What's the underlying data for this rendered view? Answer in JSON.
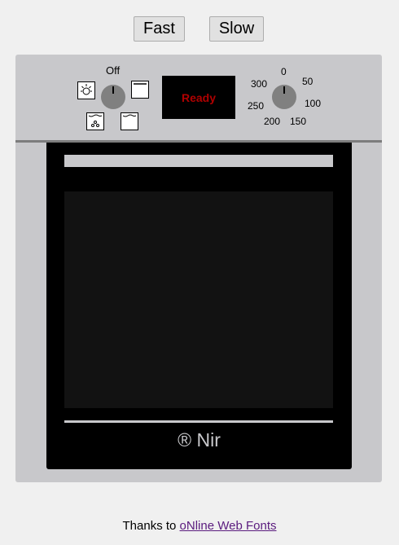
{
  "controls": {
    "fast_label": "Fast",
    "slow_label": "Slow"
  },
  "oven": {
    "mode_knob_label": "Off",
    "display_text": "Ready",
    "display_text_color": "#b00000",
    "temperature_marks": [
      "0",
      "50",
      "100",
      "150",
      "200",
      "250",
      "300"
    ],
    "mode_icons": [
      "light-icon",
      "top-heat-icon",
      "fan-icon",
      "bottom-heat-icon"
    ],
    "brand": "® Nir"
  },
  "footer": {
    "prefix": "Thanks to ",
    "link_text": "oNline Web Fonts"
  },
  "colors": {
    "body_bg": "#c8c8cb",
    "door": "#000000",
    "window": "#121212",
    "knob": "#808080",
    "link": "#5a1b7e"
  }
}
